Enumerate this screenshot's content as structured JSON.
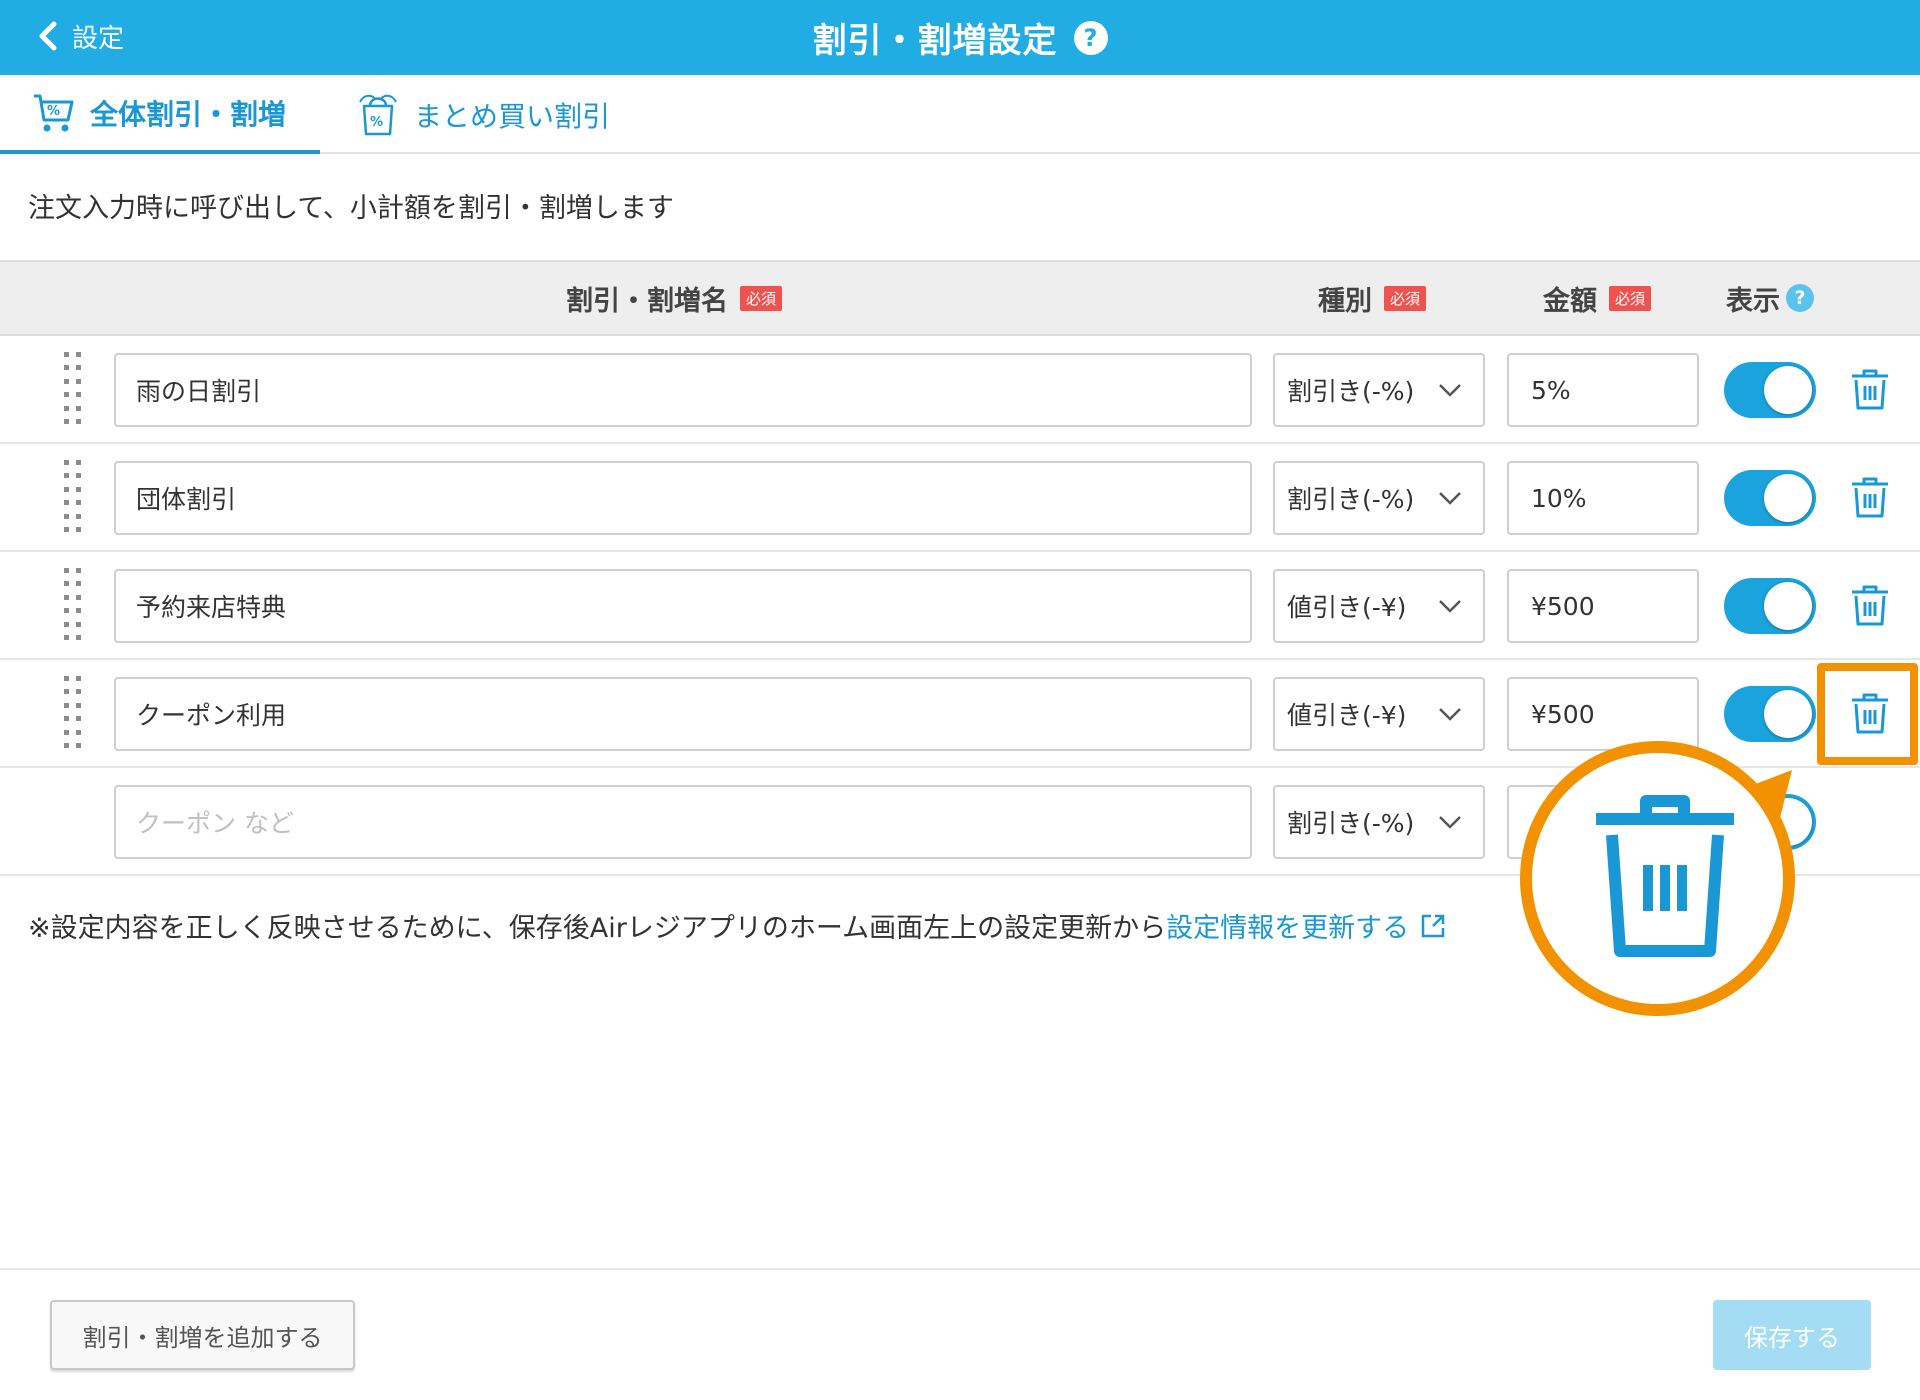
{
  "header": {
    "back_label": "設定",
    "title": "割引・割増設定",
    "help": "?"
  },
  "tabs": [
    {
      "label": "全体割引・割増",
      "active": true
    },
    {
      "label": "まとめ買い割引",
      "active": false
    }
  ],
  "description": "注文入力時に呼び出して、小計額を割引・割増します",
  "table": {
    "columns": {
      "name": "割引・割増名",
      "type": "種別",
      "amount": "金額",
      "display": "表示"
    },
    "required_badge": "必須",
    "help": "?",
    "rows": [
      {
        "name": "雨の日割引",
        "type": "割引き(-%)",
        "amount": "5%",
        "display": true
      },
      {
        "name": "団体割引",
        "type": "割引き(-%)",
        "amount": "10%",
        "display": true
      },
      {
        "name": "予約来店特典",
        "type": "値引き(-¥)",
        "amount": "¥500",
        "display": true
      },
      {
        "name": "クーポン利用",
        "type": "値引き(-¥)",
        "amount": "¥500",
        "display": true
      }
    ],
    "new_row": {
      "name_placeholder": "クーポン など",
      "type": "割引き(-%)"
    }
  },
  "note": {
    "text": "※設定内容を正しく反映させるために、保存後Airレジアプリのホーム画面左上の設定更新から",
    "link": "設定情報を更新する"
  },
  "footer": {
    "add_button": "割引・割増を追加する",
    "save_button": "保存する"
  },
  "colors": {
    "header_bg": "#21ace3",
    "accent": "#1a98d5",
    "highlight": "#f39200",
    "required": "#ef5350",
    "save_disabled": "#a3dcf3"
  }
}
